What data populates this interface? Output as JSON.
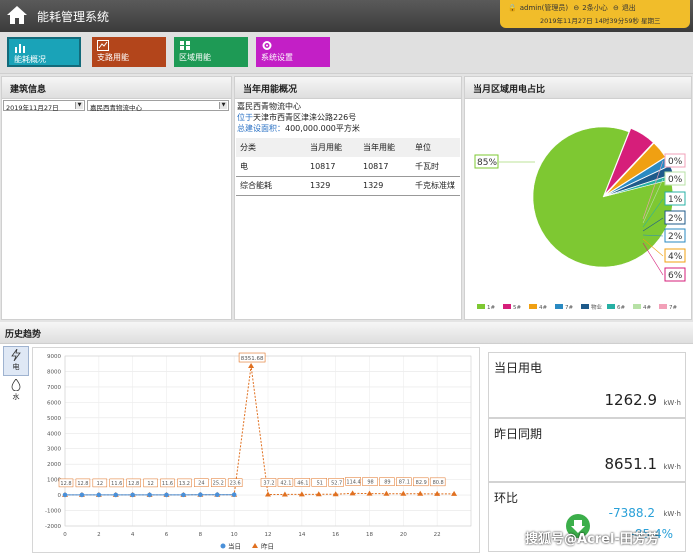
{
  "app": {
    "title": "能耗管理系统"
  },
  "user": {
    "name": "admin(管理员)",
    "message": "2条小心",
    "logout": "退出",
    "datetime": "2019年11月27日 14时39分59秒 星期三"
  },
  "nav": [
    {
      "label": "能耗概况",
      "color": "#1aa3b8"
    },
    {
      "label": "支路用能",
      "color": "#b3451b"
    },
    {
      "label": "区域用能",
      "color": "#1e9a55"
    },
    {
      "label": "系统设置",
      "color": "#c31fc6"
    }
  ],
  "building": {
    "title": "建筑信息",
    "date": "2019年11月27日",
    "site": "嘉民西青物流中心"
  },
  "year": {
    "title": "当年用能概况",
    "name": "嘉民西青物流中心",
    "location_label": "位于",
    "location": "天津市西青区津涞公路226号",
    "area_label": "总建设面积：",
    "area": "400,000.000平方米",
    "headers": [
      "分类",
      "当月用能",
      "当年用能",
      "单位"
    ],
    "rows": [
      [
        "电",
        "10817",
        "10817",
        "千瓦时"
      ],
      [
        "综合能耗",
        "1329",
        "1329",
        "千克标准煤"
      ]
    ]
  },
  "pie_title": "当月区域用电占比",
  "history_title": "历史趋势",
  "side_tabs": [
    {
      "label": "电"
    },
    {
      "label": "水"
    }
  ],
  "kpis": [
    {
      "title": "当日用电",
      "value": "1262.9",
      "unit": "kW·h"
    },
    {
      "title": "昨日同期",
      "value": "8651.1",
      "unit": "kW·h"
    },
    {
      "title": "环比",
      "value": "-7388.2",
      "unit": "kW·h",
      "pct": "-85.4%"
    }
  ],
  "watermark": "搜狐号@Acrel-田芳芳",
  "chart_data": [
    {
      "type": "pie",
      "title": "当月区域用电占比",
      "labels": [
        "1#",
        "5#",
        "4#",
        "7#",
        "物业",
        "6#",
        "4#",
        "7#"
      ],
      "values": [
        85,
        6,
        4,
        2,
        2,
        1,
        0,
        0
      ],
      "slice_labels": [
        "85%",
        "6%",
        "4%",
        "2%",
        "2%",
        "1%",
        "0%",
        "0%"
      ],
      "colors": [
        "#7ec832",
        "#d61e7a",
        "#f0a012",
        "#2a8ac2",
        "#1e5a8a",
        "#27b0a4",
        "#b7e1a6",
        "#f2a0b8"
      ],
      "legend_position": "bottom"
    },
    {
      "type": "line",
      "x": [
        0,
        1,
        2,
        3,
        4,
        5,
        6,
        7,
        8,
        9,
        10,
        11,
        12,
        13,
        14,
        15,
        16,
        17,
        18,
        19,
        20,
        21,
        22,
        23
      ],
      "series": [
        {
          "name": "当日",
          "color": "#4a90d9",
          "values": [
            12.8,
            12.8,
            12,
            11.6,
            12.8,
            12,
            11.6,
            13.2,
            24,
            25.2,
            23.6,
            null,
            null,
            null,
            null,
            null,
            null,
            null,
            null,
            null,
            null,
            null,
            null,
            null
          ],
          "labels": [
            "12.8",
            "12.8",
            "12",
            "11.6",
            "12.8",
            "12",
            "11.6",
            "13.2",
            "24",
            "25.2",
            "23.6"
          ]
        },
        {
          "name": "昨日",
          "color": "#e07020",
          "values": [
            12.8,
            12.8,
            12,
            11.6,
            12.8,
            12,
            11.6,
            13.2,
            24,
            25.2,
            23.6,
            8351.68,
            37.2,
            42.1,
            46.1,
            51,
            52.7,
            114.4,
            98,
            89,
            87.1,
            82.9,
            80.8,
            80.8
          ],
          "peak_label": "8351.68",
          "labels_right": [
            "37.2",
            "42.1",
            "46.1",
            "51",
            "52.7",
            "114.4",
            "98",
            "89",
            "87.1",
            "82.9",
            "80.8"
          ]
        }
      ],
      "ylim": [
        -2000,
        9000
      ],
      "yticks": [
        -2000,
        -1000,
        0,
        1000,
        2000,
        3000,
        4000,
        5000,
        6000,
        7000,
        8000,
        9000
      ],
      "xticks": [
        0,
        2,
        4,
        6,
        8,
        10,
        12,
        14,
        16,
        18,
        20,
        22
      ],
      "legend": [
        "当日",
        "昨日"
      ],
      "legend_position": "bottom",
      "grid": true
    }
  ]
}
